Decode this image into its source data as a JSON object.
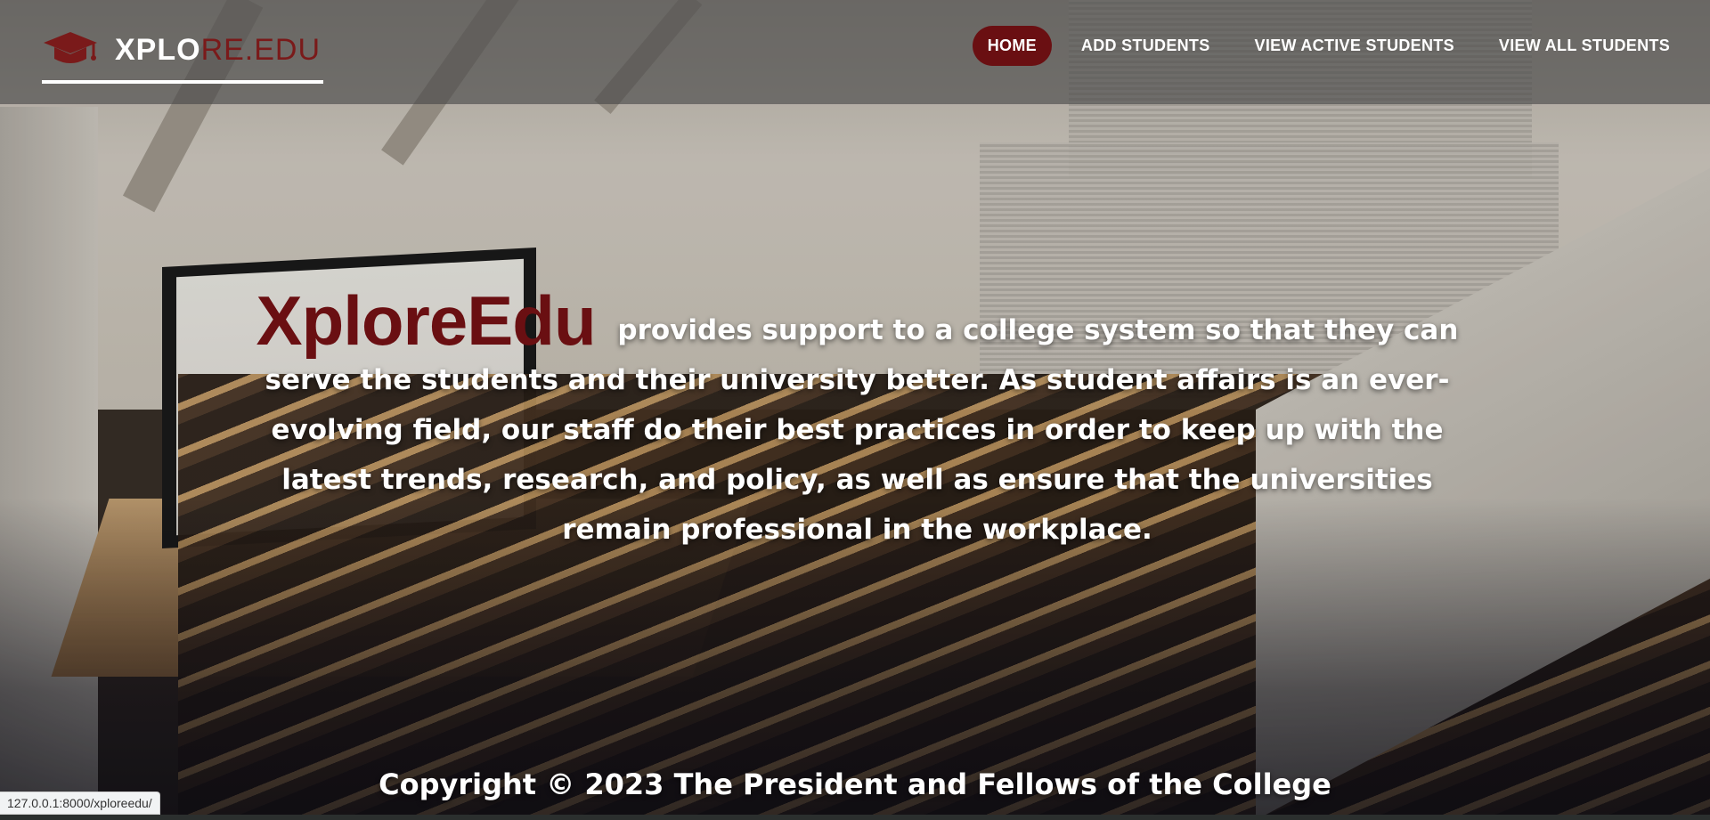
{
  "navbar": {
    "brand": {
      "part_white": "XPLO",
      "part_red": "RE.EDU",
      "icon": "graduation-cap-icon",
      "accent_color": "#7a1a1a"
    },
    "links": [
      {
        "label": "HOME",
        "active": true
      },
      {
        "label": "ADD STUDENTS",
        "active": false
      },
      {
        "label": "VIEW ACTIVE STUDENTS",
        "active": false
      },
      {
        "label": "VIEW ALL STUDENTS",
        "active": false
      }
    ],
    "active_color": "#6a0f12"
  },
  "hero": {
    "brand": "XploreEdu",
    "text": "provides support to a college system so that they can serve the students and their university better. As student affairs is an ever-evolving field, our staff do their best practices in order to keep up with the latest trends, research, and policy, as well as ensure that the universities remain professional in the workplace."
  },
  "footer": {
    "copyright": "Copyright © 2023 The President and Fellows of the College"
  },
  "status_bar": {
    "url": "127.0.0.1:8000/xploreedu/"
  }
}
